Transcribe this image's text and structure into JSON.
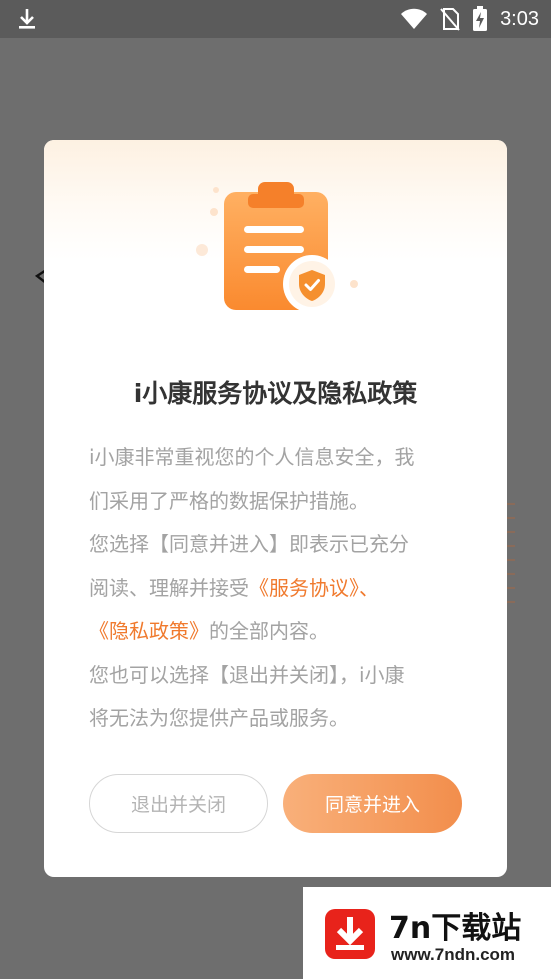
{
  "status_bar": {
    "time": "3:03",
    "icons": [
      "download-icon",
      "wifi-icon",
      "no-sim-icon",
      "battery-charging-icon"
    ]
  },
  "dialog": {
    "title": "i小康服务协议及隐私政策",
    "body": {
      "line1": "i小康非常重视您的个人信息安全，我",
      "line2": "们采用了严格的数据保护措施。",
      "line3": "您选择【同意并进入】即表示已充分",
      "line4_prefix": "阅读、理解并接受",
      "service_link": "《服务协议》、",
      "privacy_link": "《隐私政策》",
      "line5_suffix": "的全部内容。",
      "line6": "您也可以选择【退出并关闭】，i小康",
      "line7": "将无法为您提供产品或服务。"
    },
    "buttons": {
      "exit_label": "退出并关闭",
      "agree_label": "同意并进入"
    },
    "colors": {
      "accent": "#f28e4c",
      "link": "#f07a2e",
      "title": "#333333",
      "body": "#a3a3a3"
    }
  },
  "watermark": {
    "name": "7n下载站",
    "url": "www.7ndn.com"
  }
}
